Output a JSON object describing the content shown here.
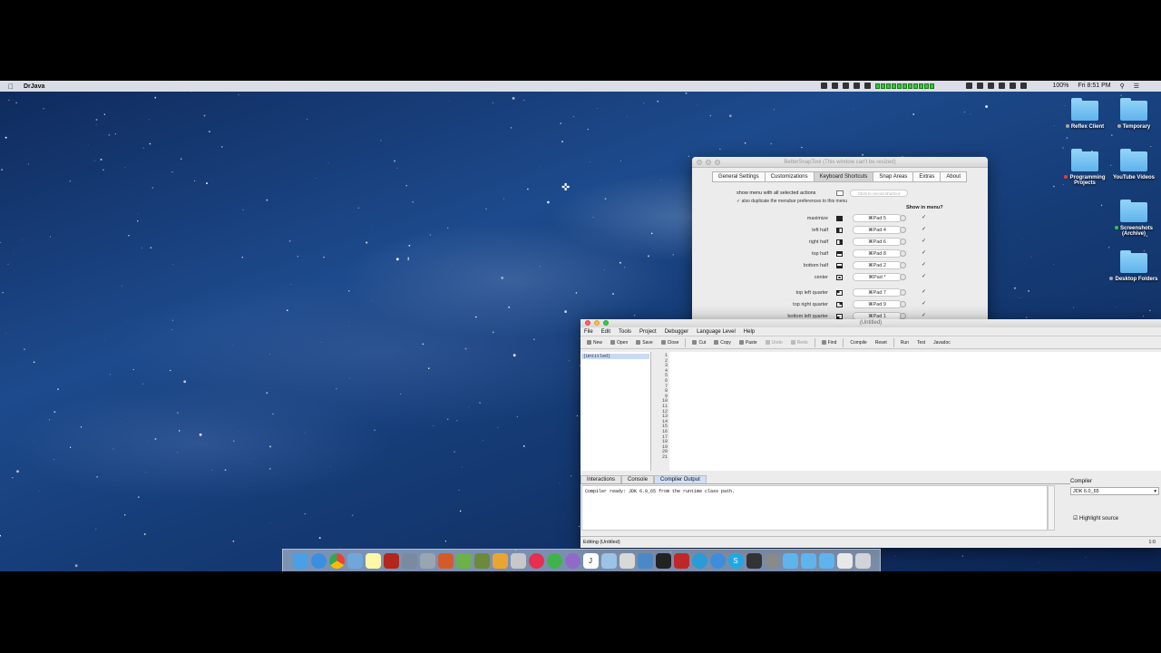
{
  "menubar": {
    "apple": "",
    "app_name": "DrJava",
    "battery": "100%",
    "clock": "Fri 8:51 PM"
  },
  "desktop_icons": [
    {
      "label": "Reflex Client",
      "dot": "#aaaaaa"
    },
    {
      "label": "Temporary",
      "dot": "#aaaaaa"
    },
    {
      "label": "Programming Projects",
      "dot": "#e04040"
    },
    {
      "label": "YouTube Videos",
      "dot": ""
    },
    {
      "label": "Screenshots (Archive)",
      "dot": "#3ac23a"
    },
    {
      "label": "Desktop Folders",
      "dot": "#aaaaaa"
    }
  ],
  "bettersnaptool": {
    "title": "BetterSnapTool (This window can't be resized)",
    "tabs": [
      "General Settings",
      "Customizations",
      "Keyboard Shortcuts",
      "Snap Areas",
      "Extras",
      "About"
    ],
    "selected_tab": "Keyboard Shortcuts",
    "show_menu_label": "show menu with all selected actions",
    "record_placeholder": "Click to record shortcut",
    "dup_label": "also duplicate the menubar preferences to this menu",
    "show_in_menu": "Show in menu?",
    "rows": [
      {
        "label": "maximize",
        "shortcut": "⌘Pad 5"
      },
      {
        "label": "left half",
        "shortcut": "⌘Pad 4"
      },
      {
        "label": "right half",
        "shortcut": "⌘Pad 6"
      },
      {
        "label": "top half",
        "shortcut": "⌘Pad 8"
      },
      {
        "label": "bottom half",
        "shortcut": "⌘Pad 2"
      },
      {
        "label": "center",
        "shortcut": "⌘Pad *"
      },
      {
        "label": "top left quarter",
        "shortcut": "⌘Pad 7"
      },
      {
        "label": "top right quarter",
        "shortcut": "⌘Pad 9"
      },
      {
        "label": "bottom left quarter",
        "shortcut": "⌘Pad 1"
      }
    ]
  },
  "drjava": {
    "title": "(Untitled)",
    "menu": [
      "File",
      "Edit",
      "Tools",
      "Project",
      "Debugger",
      "Language Level",
      "Help"
    ],
    "toolbar": {
      "new": "New",
      "open": "Open",
      "save": "Save",
      "close": "Close",
      "cut": "Cut",
      "copy": "Copy",
      "paste": "Paste",
      "undo": "Undo",
      "redo": "Redo",
      "find": "Find",
      "compile": "Compile",
      "reset": "Reset",
      "run": "Run",
      "test": "Test",
      "javadoc": "Javadoc"
    },
    "file_item": "(Untitled)",
    "line_numbers": "1\n2\n3\n4\n5\n6\n7\n8\n9\n10\n11\n12\n13\n14\n15\n16\n17\n18\n19\n20\n21",
    "bottom_tabs": [
      "Interactions",
      "Console",
      "Compiler Output"
    ],
    "selected_bottom_tab": "Compiler Output",
    "output_text": "Compiler ready: JDK 6.0_65 from the runtime class path.",
    "compiler_label": "Compiler",
    "compiler_value": "JDK 6.0_65",
    "highlight_label": "Highlight source",
    "status_text": "Editing (Untitled)",
    "cursor_pos": "1:0"
  },
  "dock": [
    "finder",
    "safari",
    "chrome",
    "preview",
    "notes",
    "acrobat",
    "photos",
    "pen",
    "toolbox",
    "maps",
    "minecraft",
    "sketch",
    "star",
    "itunes",
    "leaf",
    "ball",
    "java",
    "mail",
    "file",
    "xcode",
    "terminal",
    "calc",
    "skype-chat",
    "chat",
    "skype",
    "terminal2",
    "settings",
    "folder",
    "folder2",
    "folder3",
    "downloads",
    "trash"
  ]
}
